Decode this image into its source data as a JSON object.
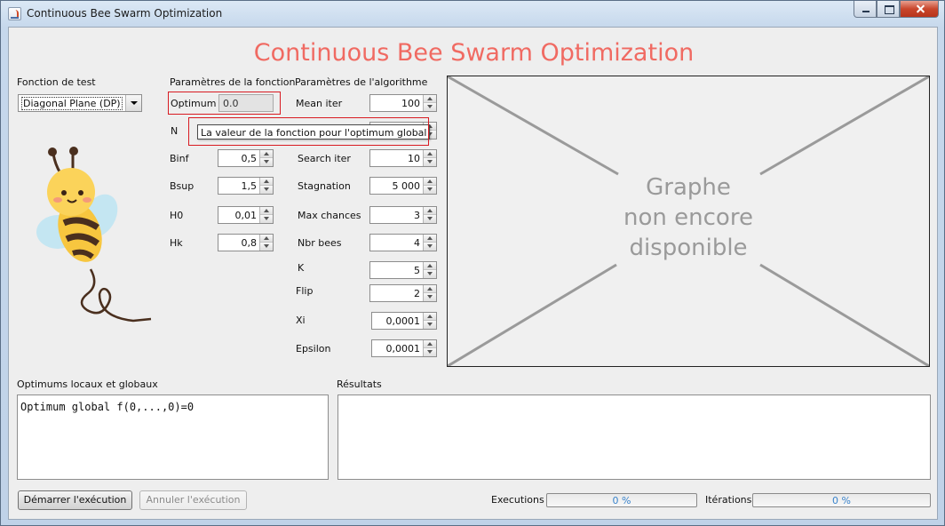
{
  "window": {
    "title": "Continuous Bee Swarm Optimization"
  },
  "app_title": "Continuous Bee Swarm Optimization",
  "test_function": {
    "label": "Fonction de test",
    "selected": "Diagonal Plane (DP)"
  },
  "function_params": {
    "label": "Paramètres de la fonction",
    "optimum": {
      "label": "Optimum",
      "value": "0.0"
    },
    "n": {
      "label": "N"
    },
    "binf": {
      "label": "Binf",
      "value": "0,5"
    },
    "bsup": {
      "label": "Bsup",
      "value": "1,5"
    },
    "h0": {
      "label": "H0",
      "value": "0,01"
    },
    "hk": {
      "label": "Hk",
      "value": "0,8"
    }
  },
  "tooltip": "La valeur de la fonction pour l'optimum global",
  "algorithm_params": {
    "label": "Paramètres de l'algorithme",
    "mean_iter": {
      "label": "Mean iter",
      "value": "100"
    },
    "search_iter": {
      "label": "Search iter",
      "value": "10"
    },
    "stagnation": {
      "label": "Stagnation",
      "value": "5 000"
    },
    "max_chances": {
      "label": "Max chances",
      "value": "3"
    },
    "nbr_bees": {
      "label": "Nbr bees",
      "value": "4"
    },
    "k": {
      "label": "K",
      "value": "5"
    },
    "flip": {
      "label": "Flip",
      "value": "2"
    },
    "xi": {
      "label": "Xi",
      "value": "0,0001"
    },
    "epsilon": {
      "label": "Epsilon",
      "value": "0,0001"
    }
  },
  "graph": {
    "line1": "Graphe",
    "line2": "non encore",
    "line3": "disponible"
  },
  "optimums": {
    "label": "Optimums locaux et globaux",
    "content": "Optimum global f(0,...,0)=0"
  },
  "results": {
    "label": "Résultats",
    "content": ""
  },
  "buttons": {
    "start": "Démarrer l'exécution",
    "cancel": "Annuler l'exécution"
  },
  "progress": {
    "executions": {
      "label": "Executions",
      "percent": 0,
      "text": "0 %"
    },
    "iterations": {
      "label": "Itérations",
      "percent": 0,
      "text": "0 %"
    }
  },
  "colors": {
    "title": "#f06a62",
    "highlight": "#d81b22",
    "progress_text": "#3a84cc"
  }
}
